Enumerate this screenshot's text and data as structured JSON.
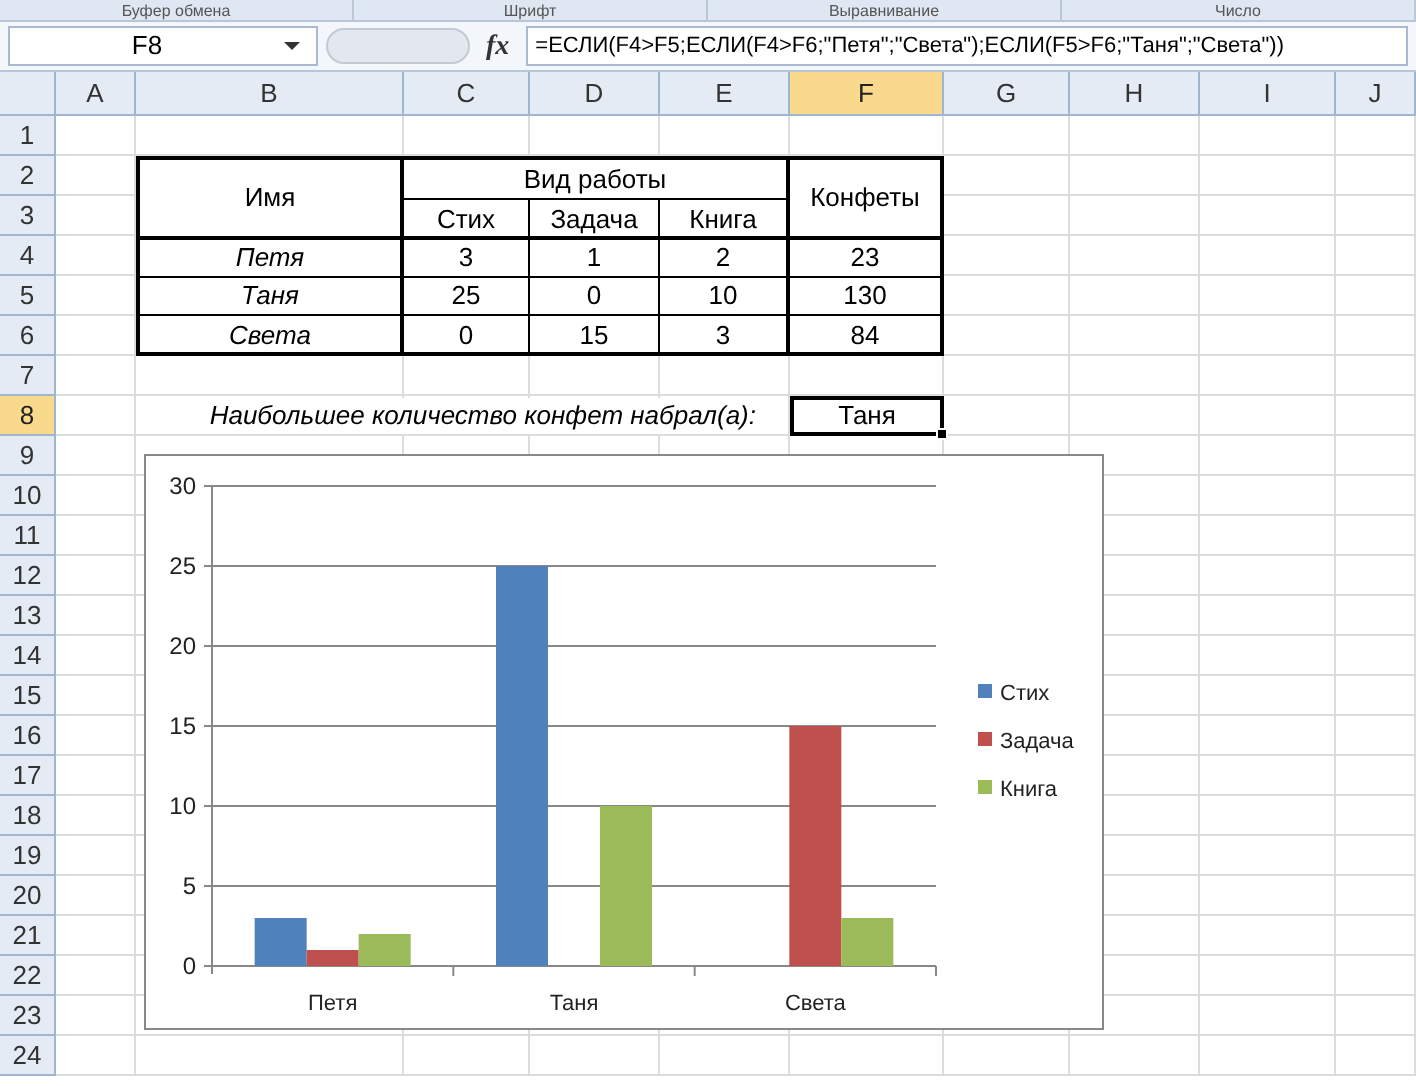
{
  "ribbon_groups": [
    "Буфер обмена",
    "Шрифт",
    "Выравнивание",
    "Число"
  ],
  "formula_bar": {
    "name_box": "F8",
    "fx_label": "fx",
    "formula": "=ЕСЛИ(F4>F5;ЕСЛИ(F4>F6;\"Петя\";\"Света\");ЕСЛИ(F5>F6;\"Таня\";\"Света\"))"
  },
  "columns": [
    {
      "label": "A",
      "selected": false
    },
    {
      "label": "B",
      "selected": false
    },
    {
      "label": "C",
      "selected": false
    },
    {
      "label": "D",
      "selected": false
    },
    {
      "label": "E",
      "selected": false
    },
    {
      "label": "F",
      "selected": true
    },
    {
      "label": "G",
      "selected": false
    },
    {
      "label": "H",
      "selected": false
    },
    {
      "label": "I",
      "selected": false
    },
    {
      "label": "J",
      "selected": false
    }
  ],
  "rows": [
    {
      "label": "1",
      "selected": false
    },
    {
      "label": "2",
      "selected": false
    },
    {
      "label": "3",
      "selected": false
    },
    {
      "label": "4",
      "selected": false
    },
    {
      "label": "5",
      "selected": false
    },
    {
      "label": "6",
      "selected": false
    },
    {
      "label": "7",
      "selected": false
    },
    {
      "label": "8",
      "selected": true
    },
    {
      "label": "9",
      "selected": false
    },
    {
      "label": "10",
      "selected": false
    },
    {
      "label": "11",
      "selected": false
    },
    {
      "label": "12",
      "selected": false
    },
    {
      "label": "13",
      "selected": false
    },
    {
      "label": "14",
      "selected": false
    },
    {
      "label": "15",
      "selected": false
    },
    {
      "label": "16",
      "selected": false
    },
    {
      "label": "17",
      "selected": false
    },
    {
      "label": "18",
      "selected": false
    },
    {
      "label": "19",
      "selected": false
    },
    {
      "label": "20",
      "selected": false
    },
    {
      "label": "21",
      "selected": false
    },
    {
      "label": "22",
      "selected": false
    },
    {
      "label": "23",
      "selected": false
    },
    {
      "label": "24",
      "selected": false
    }
  ],
  "table": {
    "name_header": "Имя",
    "group_header": "Вид работы",
    "subheaders": [
      "Стих",
      "Задача",
      "Книга"
    ],
    "total_header": "Конфеты",
    "rows": [
      {
        "name": "Петя",
        "values": [
          "3",
          "1",
          "2"
        ],
        "total": "23"
      },
      {
        "name": "Таня",
        "values": [
          "25",
          "0",
          "10"
        ],
        "total": "130"
      },
      {
        "name": "Света",
        "values": [
          "0",
          "15",
          "3"
        ],
        "total": "84"
      }
    ]
  },
  "result": {
    "label": "Наибольшее количество конфет набрал(а):",
    "value": "Таня",
    "selected": true
  },
  "chart": {
    "chart_data": {
      "type": "bar",
      "categories": [
        "Петя",
        "Таня",
        "Света"
      ],
      "series": [
        {
          "name": "Стих",
          "color": "#4f81bd",
          "values": [
            3,
            25,
            0
          ]
        },
        {
          "name": "Задача",
          "color": "#c0504d",
          "values": [
            1,
            0,
            15
          ]
        },
        {
          "name": "Книга",
          "color": "#9bbb59",
          "values": [
            2,
            10,
            3
          ]
        }
      ],
      "ylim": [
        0,
        30
      ],
      "yticks": [
        0,
        5,
        10,
        15,
        20,
        25,
        30
      ],
      "grid": true,
      "legend": true
    }
  }
}
